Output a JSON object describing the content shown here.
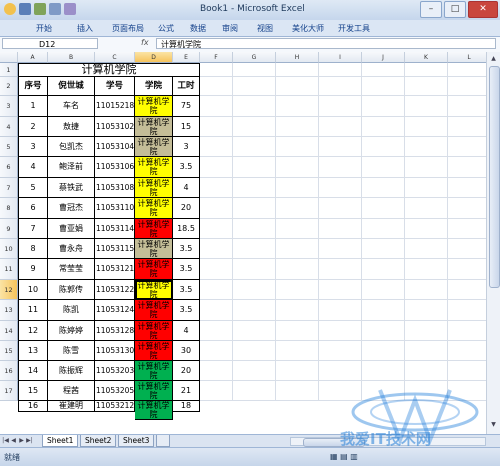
{
  "window": {
    "title": "Book1 - Microsoft Excel"
  },
  "ribbon": {
    "tabs": [
      "开始",
      "插入",
      "页面布局",
      "公式",
      "数据",
      "审阅",
      "视图",
      "美化大师",
      "开发工具"
    ]
  },
  "formula": {
    "name_box": "D12",
    "fx_label": "fx",
    "value": "计算机学院"
  },
  "columns": [
    "A",
    "B",
    "C",
    "D",
    "E",
    "F",
    "G",
    "H",
    "I",
    "J",
    "K",
    "L"
  ],
  "rows": [
    "1",
    "2",
    "3",
    "4",
    "5",
    "6",
    "7",
    "8",
    "9",
    "10",
    "11",
    "12",
    "13",
    "14",
    "15",
    "16",
    "17"
  ],
  "sheet": {
    "title": "计算机学院",
    "headers": [
      "序号",
      "倪世城",
      "学号",
      "学院",
      "工时"
    ],
    "records": [
      {
        "no": "1",
        "name": "车名",
        "id": "11015218",
        "college": "计算机学院",
        "hours": "75",
        "color": "#fffe00"
      },
      {
        "no": "2",
        "name": "敖捷",
        "id": "11053102",
        "college": "计算机学院",
        "hours": "15",
        "color": "#c4bd97"
      },
      {
        "no": "3",
        "name": "包凯杰",
        "id": "11053104",
        "college": "计算机学院",
        "hours": "3",
        "color": "#c4bd97"
      },
      {
        "no": "4",
        "name": "鲍泽前",
        "id": "11053106",
        "college": "计算机学院",
        "hours": "3.5",
        "color": "#fffe00"
      },
      {
        "no": "5",
        "name": "蔡铁武",
        "id": "11053108",
        "college": "计算机学院",
        "hours": "4",
        "color": "#fffe00"
      },
      {
        "no": "6",
        "name": "曹冠杰",
        "id": "11053110",
        "college": "计算机学院",
        "hours": "20",
        "color": "#fffe00"
      },
      {
        "no": "7",
        "name": "曹亚娟",
        "id": "11053114",
        "college": "计算机学院",
        "hours": "18.5",
        "color": "#ff0000"
      },
      {
        "no": "8",
        "name": "曹永舟",
        "id": "11053115",
        "college": "计算机学院",
        "hours": "3.5",
        "color": "#c4bd97"
      },
      {
        "no": "9",
        "name": "常莹莹",
        "id": "11053121",
        "college": "计算机学院",
        "hours": "3.5",
        "color": "#ff0000"
      },
      {
        "no": "10",
        "name": "陈郭传",
        "id": "11053122",
        "college": "计算机学院",
        "hours": "3.5",
        "color": "#fffe00"
      },
      {
        "no": "11",
        "name": "陈凯",
        "id": "11053124",
        "college": "计算机学院",
        "hours": "3.5",
        "color": "#ff0000"
      },
      {
        "no": "12",
        "name": "陈婷婷",
        "id": "11053128",
        "college": "计算机学院",
        "hours": "4",
        "color": "#ff0000"
      },
      {
        "no": "13",
        "name": "陈雪",
        "id": "11053130",
        "college": "计算机学院",
        "hours": "30",
        "color": "#ff0000"
      },
      {
        "no": "14",
        "name": "陈振辉",
        "id": "11053203",
        "college": "计算机学院",
        "hours": "20",
        "color": "#00b050"
      },
      {
        "no": "15",
        "name": "程茜",
        "id": "11053205",
        "college": "计算机学院",
        "hours": "21",
        "color": "#00b050"
      },
      {
        "no": "16",
        "name": "崔建明",
        "id": "11053212",
        "college": "计算机学院",
        "hours": "18",
        "color": "#00b050"
      }
    ]
  },
  "sheet_tabs": [
    "Sheet1",
    "Sheet2",
    "Sheet3"
  ],
  "status": {
    "text": "就绪"
  },
  "watermark": {
    "text": "我爱IT技术网"
  }
}
